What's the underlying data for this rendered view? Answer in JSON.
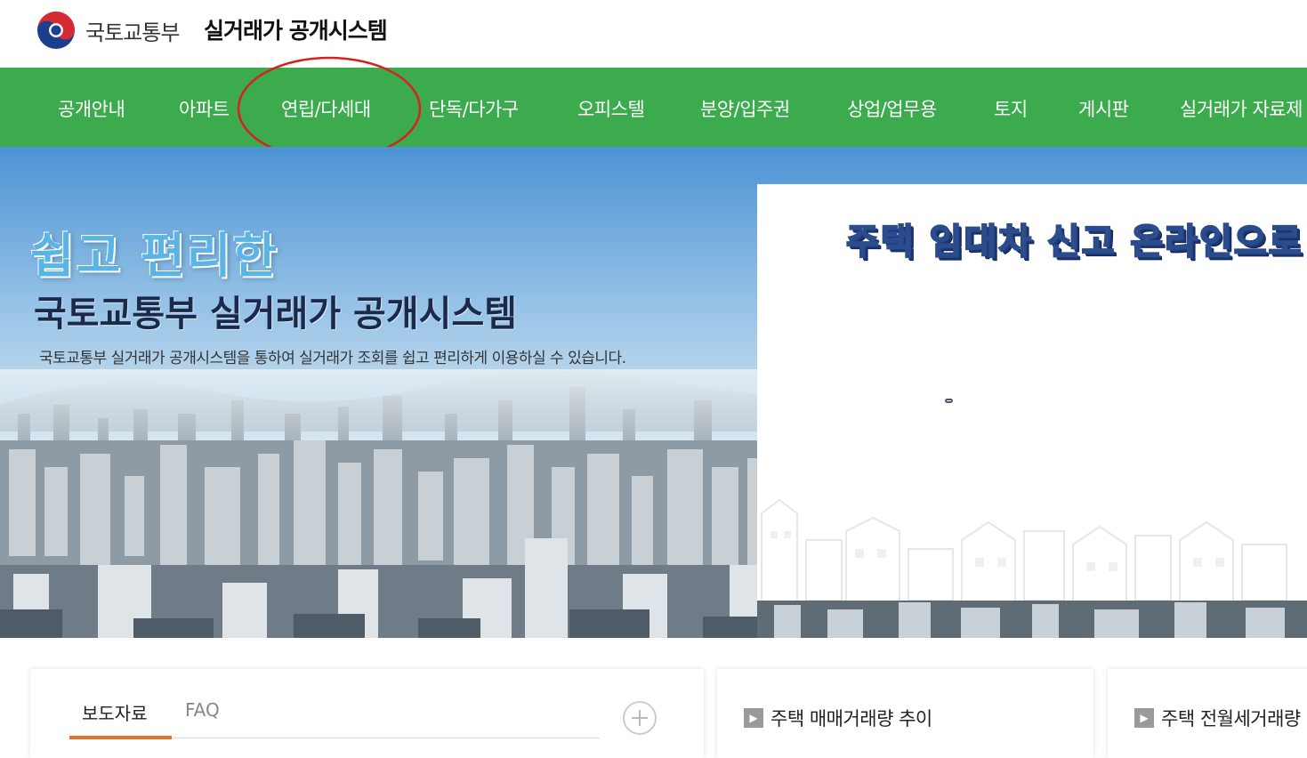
{
  "header": {
    "ministry": "국토교통부",
    "system_name": "실거래가 공개시스템"
  },
  "nav": {
    "items": [
      {
        "label": "공개안내"
      },
      {
        "label": "아파트"
      },
      {
        "label": "연립/다세대"
      },
      {
        "label": "단독/다가구"
      },
      {
        "label": "오피스텔"
      },
      {
        "label": "분양/입주권"
      },
      {
        "label": "상업/업무용"
      },
      {
        "label": "토지"
      },
      {
        "label": "게시판"
      },
      {
        "label": "실거래가 자료제"
      }
    ],
    "highlighted": "연립/다세대"
  },
  "hero": {
    "title_line1": "쉽고 편리한",
    "title_line2": "국토교통부 실거래가 공개시스템",
    "description": "국토교통부 실거래가 공개시스템을 통하여 실거래가 조회를 쉽고 편리하게 이용하실 수 있습니다."
  },
  "banner": {
    "headline": "주택 임대차 신고 온라인으로 진"
  },
  "news_panel": {
    "tabs": [
      "보도자료",
      "FAQ"
    ],
    "active_tab": "보도자료",
    "more_icon": "plus-circle-icon"
  },
  "trend_panel": {
    "title": "주택 매매거래량 추이"
  },
  "rent_panel": {
    "title": "주택 전월세거래량"
  },
  "colors": {
    "nav_green": "#3cab4e",
    "tab_active_orange": "#e8712a",
    "annotation_red": "#d9201f",
    "hero_title_blue": "#5ab4e6",
    "hero_title_navy": "#1b2a4c"
  }
}
